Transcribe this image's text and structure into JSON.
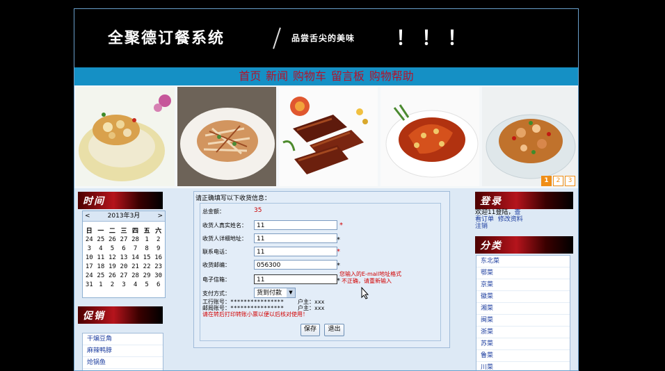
{
  "banner": {
    "title": "全聚德订餐系统",
    "slogan": "品尝舌尖的美味",
    "exclaim": "！！！"
  },
  "nav": [
    "首页",
    "新闻",
    "购物车",
    "留言板",
    "购物帮助"
  ],
  "photos": [
    {
      "icon": "dish-photo-icon",
      "plate": "#f0f2e8",
      "food": "#e7c77b"
    },
    {
      "icon": "dish-photo-icon",
      "plate": "#f6f0ea",
      "food": "#c9865a"
    },
    {
      "icon": "dish-photo-icon",
      "plate": "#fdfdfd",
      "food": "#6e2410"
    },
    {
      "icon": "dish-photo-icon",
      "plate": "#ffffff",
      "food": "#b93a14"
    },
    {
      "icon": "dish-photo-icon",
      "plate": "#e9eef0",
      "food": "#c06d2a"
    }
  ],
  "pager": [
    "1",
    "2",
    "3"
  ],
  "left": {
    "time_title": "时间",
    "promo_title": "促销",
    "calendar": {
      "prev": "<",
      "next": ">",
      "month": "2013年3月",
      "weekdays": [
        "日",
        "一",
        "二",
        "三",
        "四",
        "五",
        "六"
      ],
      "weeks": [
        [
          "24",
          "25",
          "26",
          "27",
          "28",
          "1",
          "2"
        ],
        [
          "3",
          "4",
          "5",
          "6",
          "7",
          "8",
          "9"
        ],
        [
          "10",
          "11",
          "12",
          "13",
          "14",
          "15",
          "16"
        ],
        [
          "17",
          "18",
          "19",
          "20",
          "21",
          "22",
          "23"
        ],
        [
          "24",
          "25",
          "26",
          "27",
          "28",
          "29",
          "30"
        ],
        [
          "31",
          "1",
          "2",
          "3",
          "4",
          "5",
          "6"
        ]
      ]
    },
    "promo_items": [
      "干煸豆角",
      "麻辣鸭脖",
      "炝锅鱼"
    ]
  },
  "form": {
    "intro": "请正确填写以下收货信息：",
    "total_label": "总金额：",
    "total_value": "35",
    "name_label": "收货人真实姓名：",
    "name_value": "11",
    "address_label": "收货人详细地址：",
    "address_value": "11",
    "phone_label": "联系电话：",
    "phone_value": "11",
    "zip_label": "收货邮编：",
    "zip_value": "056300",
    "email_label": "电子信箱：",
    "email_value": "11",
    "star": "*",
    "email_error_1": "您输入的E-mail地址格式",
    "email_error_2": "不正确，请重新输入",
    "pay_label": "支付方式：",
    "pay_value": "货到付款",
    "bank1": "工行账号：****************",
    "owner1": "户主：xxx",
    "bank2": "邮局账号：****************",
    "owner2": "户主：xxx",
    "note": "请在转后打印转账小票以便以后核对使用！",
    "save": "保存",
    "exit": "退出"
  },
  "right": {
    "login_title": "登录",
    "welcome": "欢迎11登陆，",
    "check": "查",
    "orders": "看订单",
    "edit": "修改资料",
    "logout": "注销",
    "category_title": "分类",
    "categories": [
      "东北菜",
      "鄂菜",
      "京菜",
      "徽菜",
      "湘菜",
      "闽菜",
      "浙菜",
      "苏菜",
      "鲁菜",
      "川菜"
    ]
  },
  "colors": {
    "accent": "#1590c5",
    "nav_text": "#b4122a",
    "error": "#d20000",
    "pager": "#f08e16"
  }
}
